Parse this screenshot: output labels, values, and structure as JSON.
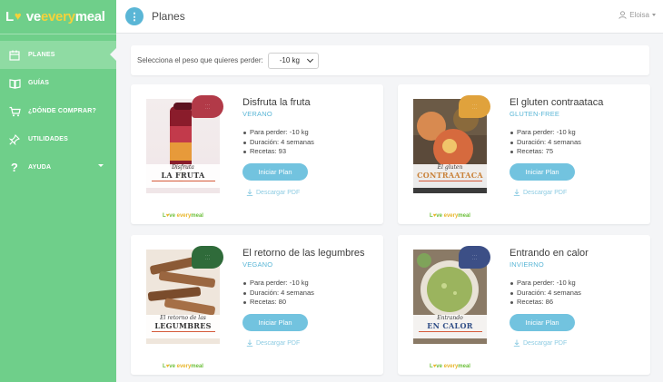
{
  "logo": {
    "part1": "L",
    "part2": "ve",
    "part3": "every",
    "part4": "meal"
  },
  "sidebar": {
    "items": [
      {
        "label": "PLANES"
      },
      {
        "label": "GUÍAS"
      },
      {
        "label": "¿DÓNDE COMPRAR?"
      },
      {
        "label": "UTILIDADES"
      },
      {
        "label": "AYUDA"
      }
    ]
  },
  "header": {
    "menu_glyph": "⋮",
    "title": "Planes",
    "user": "Eloisa"
  },
  "filter": {
    "label": "Selecciona el peso que quieres perder:",
    "selected": "-10 kg"
  },
  "plans": [
    {
      "title": "Disfruta la fruta",
      "season": "VERANO",
      "weight": "Para perder: -10 kg",
      "duration": "Duración: 4 semanas",
      "recipes": "Recetas: 93",
      "cover_line1": "Disfruta",
      "cover_line2": "LA FRUTA",
      "badge_color": "#b23a48",
      "button": "Iniciar Plan",
      "pdf": "Descargar PDF"
    },
    {
      "title": "El gluten contraataca",
      "season": "GLUTEN-FREE",
      "weight": "Para perder: -10 kg",
      "duration": "Duración: 4 semanas",
      "recipes": "Recetas: 75",
      "cover_line1": "El gluten",
      "cover_line2": "CONTRAATACA",
      "badge_color": "#e0a23c",
      "button": "Iniciar Plan",
      "pdf": "Descargar PDF"
    },
    {
      "title": "El retorno de las legumbres",
      "season": "VEGANO",
      "weight": "Para perder: -10 kg",
      "duration": "Duración: 4 semanas",
      "recipes": "Recetas: 80",
      "cover_line1": "El retorno de las",
      "cover_line2": "LEGUMBRES",
      "badge_color": "#2f6b3a",
      "button": "Iniciar Plan",
      "pdf": "Descargar PDF"
    },
    {
      "title": "Entrando en calor",
      "season": "INVIERNO",
      "weight": "Para perder: -10 kg",
      "duration": "Duración: 4 semanas",
      "recipes": "Recetas: 86",
      "cover_line1": "Entrando",
      "cover_line2": "EN CALOR",
      "badge_color": "#3c4f86",
      "button": "Iniciar Plan",
      "pdf": "Descargar PDF"
    }
  ],
  "colors": {
    "sidebar": "#6fcf8a",
    "accent": "#5ab6d6",
    "button": "#72c3df"
  }
}
